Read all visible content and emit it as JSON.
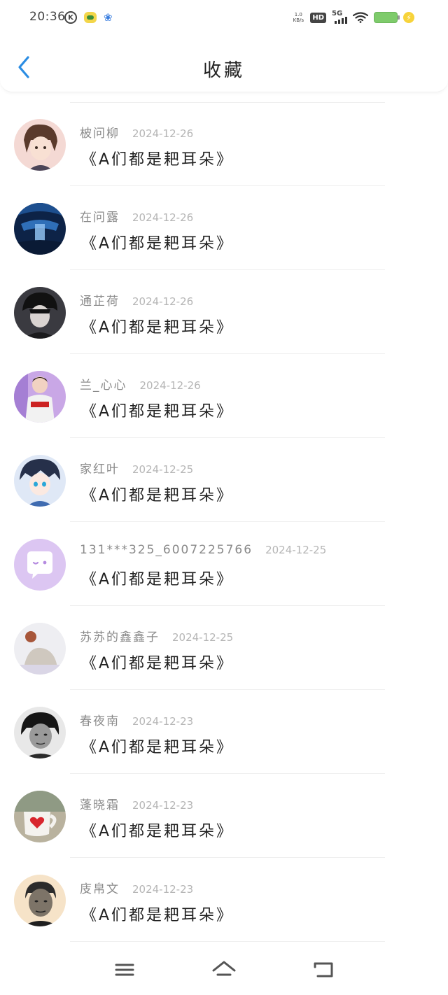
{
  "status_bar": {
    "time": "20:36",
    "network_speed": "1.0 KB/s",
    "hd_label": "HD",
    "signal_label": "5G",
    "icons": [
      "k-circle-icon",
      "app-notification-icon",
      "paw-icon",
      "hd-icon",
      "signal-5g-icon",
      "wifi-icon",
      "battery-icon",
      "charging-bolt-icon"
    ],
    "battery_color": "#7ecb6b"
  },
  "header": {
    "title": "收藏",
    "back_icon": "chevron-left-icon",
    "accent_color": "#2b8de3"
  },
  "favorites": [
    {
      "username": "柀问柳",
      "date": "2024-12-26",
      "title": "《A们都是耙耳朵》",
      "avatar": "anime-boy-brown-hair"
    },
    {
      "username": "在问露",
      "date": "2024-12-26",
      "title": "《A们都是耙耳朵》",
      "avatar": "blue-waterfall-landscape"
    },
    {
      "username": "通芷荷",
      "date": "2024-12-26",
      "title": "《A们都是耙耳朵》",
      "avatar": "dark-haired-boy"
    },
    {
      "username": "兰_心心",
      "date": "2024-12-26",
      "title": "《A们都是耙耳朵》",
      "avatar": "boy-in-jersey"
    },
    {
      "username": "家红叶",
      "date": "2024-12-25",
      "title": "《A们都是耙耳朵》",
      "avatar": "anime-boy-blue-eyes"
    },
    {
      "username": "131***325_6007225766",
      "date": "2024-12-25",
      "title": "《A们都是耙耳朵》",
      "avatar": "default-chat-bubble"
    },
    {
      "username": "苏苏的鑫鑫子",
      "date": "2024-12-25",
      "title": "《A们都是耙耳朵》",
      "avatar": "sitting-person-light"
    },
    {
      "username": "春夜南",
      "date": "2024-12-23",
      "title": "《A们都是耙耳朵》",
      "avatar": "bw-portrait-woman"
    },
    {
      "username": "蓬晓霜",
      "date": "2024-12-23",
      "title": "《A们都是耙耳朵》",
      "avatar": "heart-mug"
    },
    {
      "username": "庋帛文",
      "date": "2024-12-23",
      "title": "《A们都是耙耳朵》",
      "avatar": "bw-portrait-man"
    }
  ],
  "nav_bar": {
    "icons": [
      "menu-icon",
      "home-icon",
      "back-arrow-icon"
    ]
  }
}
